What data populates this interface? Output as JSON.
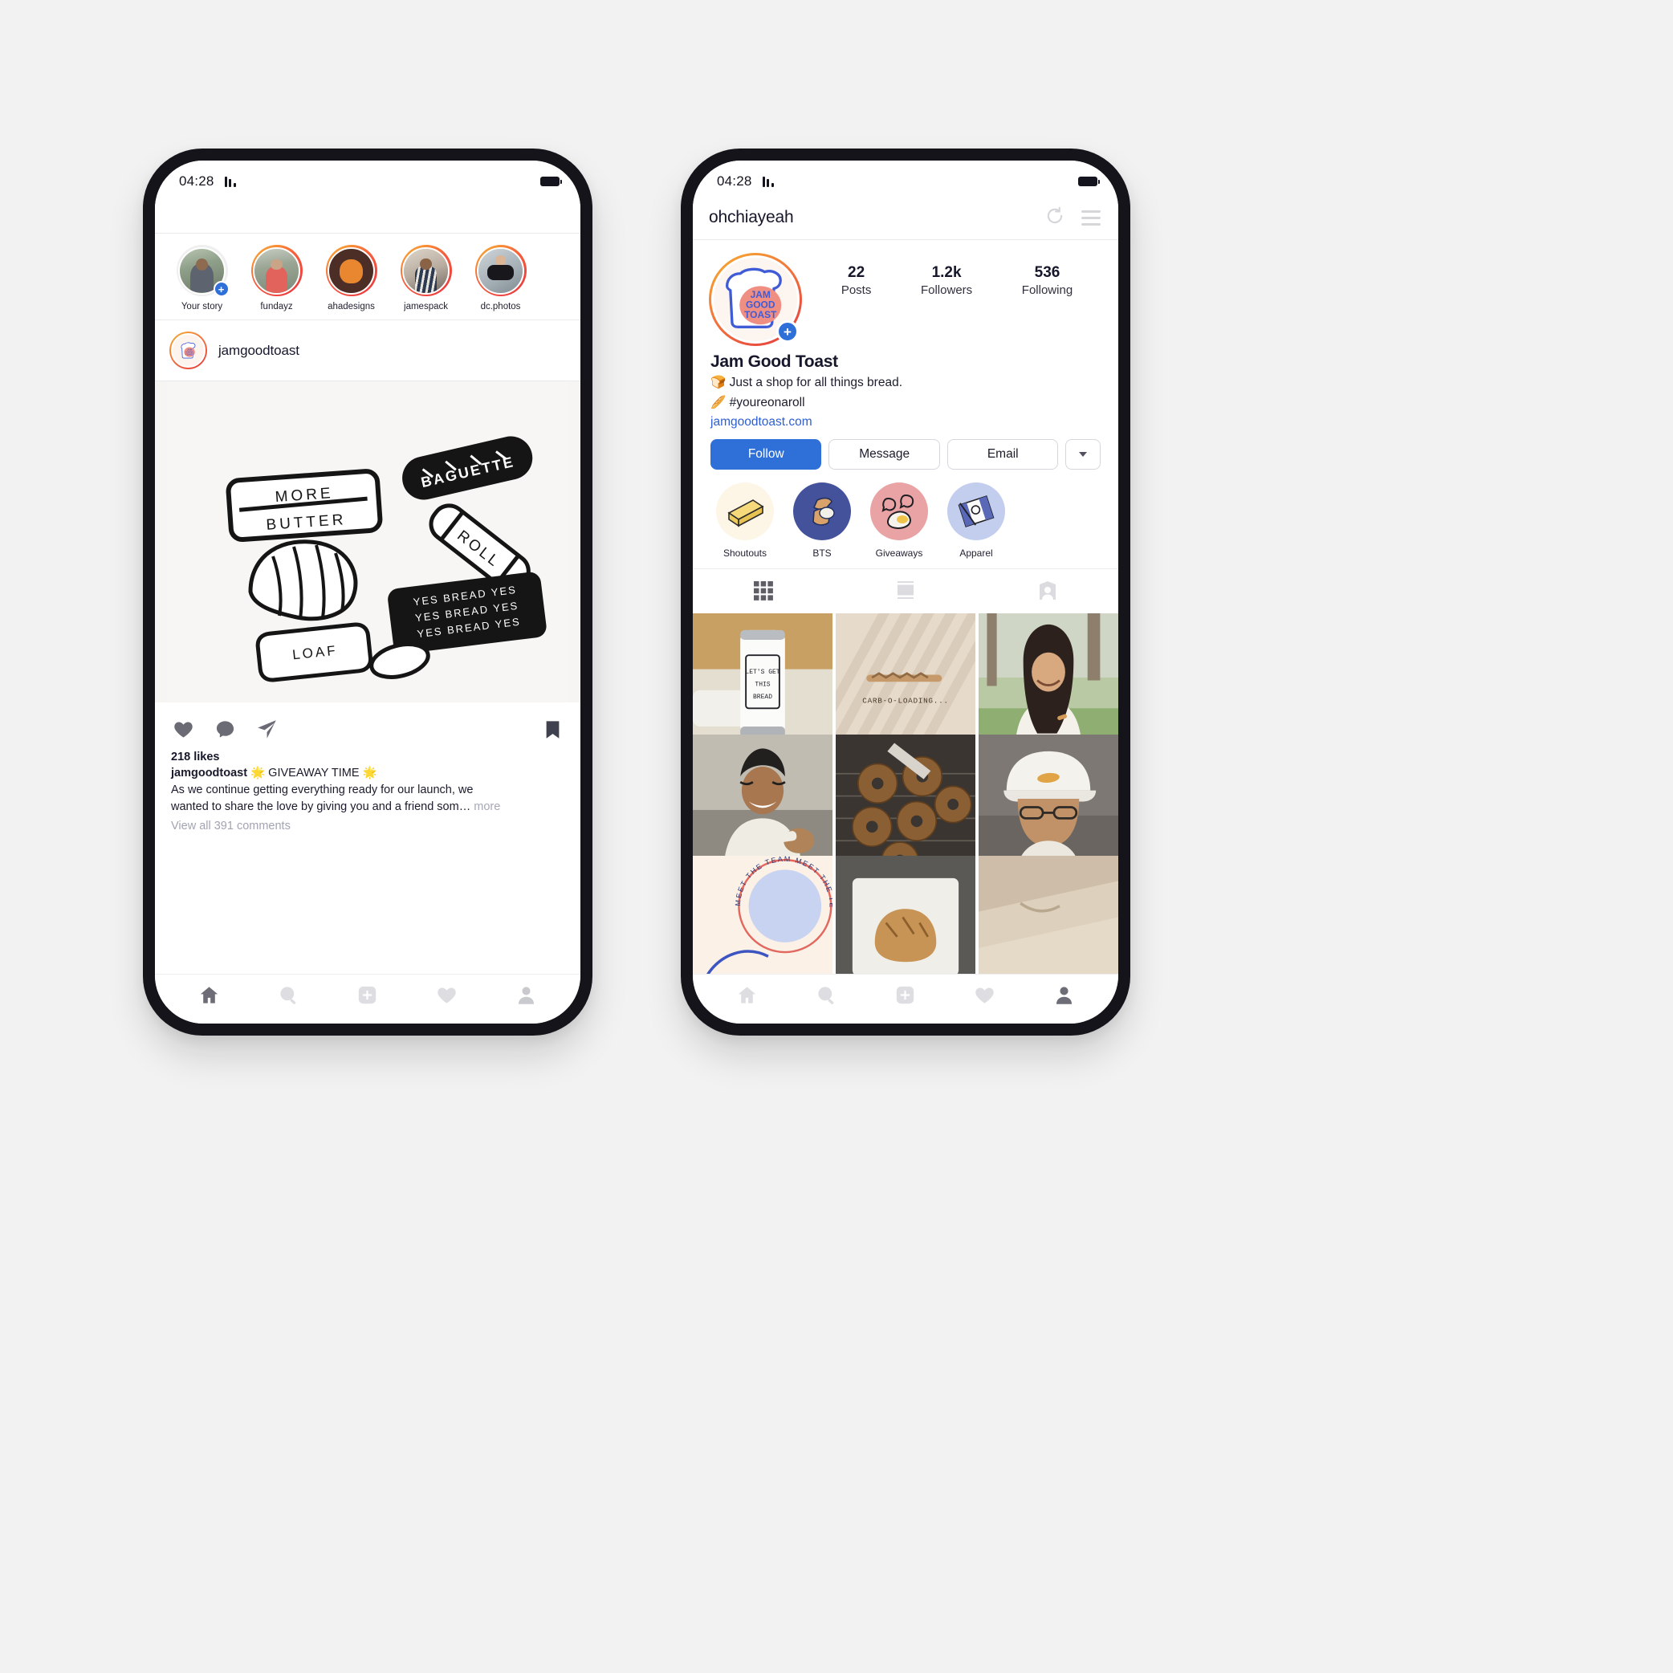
{
  "status_bar": {
    "time": "04:28",
    "signal_icon": "signal-bars-icon",
    "battery_icon": "battery-icon"
  },
  "feed_phone": {
    "stories": [
      {
        "label": "Your story",
        "has_ring": false,
        "has_add": true,
        "avatar": "woman-in-park-avatar"
      },
      {
        "label": "fundayz",
        "has_ring": true,
        "has_add": false,
        "avatar": "woman-red-top-avatar"
      },
      {
        "label": "ahadesigns",
        "has_ring": true,
        "has_add": false,
        "avatar": "illustrated-face-avatar"
      },
      {
        "label": "jamespack",
        "has_ring": true,
        "has_add": false,
        "avatar": "man-striped-shirt-avatar"
      },
      {
        "label": "dc.photos",
        "has_ring": true,
        "has_add": false,
        "avatar": "photographer-camera-avatar"
      }
    ],
    "post": {
      "username": "jamgoodtoast",
      "avatar_name": "jam-good-toast-logo",
      "image_alt": "bread-sticker-flatlay",
      "stickers": [
        {
          "text": "MORE BUTTER",
          "style": "outline"
        },
        {
          "text": "BAGUETTE",
          "style": "black"
        },
        {
          "text": "ROLL",
          "style": "outline"
        },
        {
          "text": "YES BREAD YES BREAD YES BREAD YES",
          "style": "black"
        },
        {
          "text": "LOAF",
          "style": "outline"
        },
        {
          "text": "croissant",
          "style": "outline"
        }
      ],
      "likes": "218 likes",
      "caption_user": "jamgoodtoast",
      "caption_headline": "🌟 GIVEAWAY TIME 🌟",
      "caption_line1": "As we continue getting everything ready for our launch, we",
      "caption_line2": "wanted to share the love by giving you and a friend som…",
      "caption_more": "more",
      "comments": "View all 391 comments",
      "actions": [
        "heart-icon",
        "comment-icon",
        "share-icon",
        "bookmark-icon"
      ]
    },
    "bottom_nav": [
      "home-icon",
      "search-icon",
      "add-post-icon",
      "heart-icon",
      "profile-icon"
    ]
  },
  "profile_phone": {
    "header": {
      "handle": "ohchiayeah",
      "refresh_icon": "refresh-icon",
      "menu_icon": "hamburger-menu-icon"
    },
    "avatar_name": "jam-good-toast-logo",
    "avatar_add_badge": "+",
    "stats": [
      {
        "value": "22",
        "label": "Posts"
      },
      {
        "value": "1.2k",
        "label": "Followers"
      },
      {
        "value": "536",
        "label": "Following"
      }
    ],
    "bio": {
      "name": "Jam Good Toast",
      "line1": "🍞 Just a shop for all things bread.",
      "line2": "🥖 #youreonaroll",
      "link": "jamgoodtoast.com"
    },
    "buttons": {
      "follow": "Follow",
      "message": "Message",
      "email": "Email",
      "more_icon": "chevron-down-icon"
    },
    "highlights": [
      {
        "label": "Shoutouts",
        "color": "#fdf5e6",
        "icon": "butter-stick-icon"
      },
      {
        "label": "BTS",
        "color": "#44529b",
        "icon": "bread-slices-icon"
      },
      {
        "label": "Giveaways",
        "color": "#e9a3a4",
        "icon": "egg-speech-icon"
      },
      {
        "label": "Apparel",
        "color": "#c3cdee",
        "icon": "tshirt-tag-icon"
      }
    ],
    "tabs": [
      {
        "name": "grid-tab",
        "icon": "grid-icon",
        "active": true
      },
      {
        "name": "feed-tab",
        "icon": "list-view-icon",
        "active": false
      },
      {
        "name": "tagged-tab",
        "icon": "tagged-person-icon",
        "active": false
      }
    ],
    "grid": [
      {
        "caption": "LET'S GET THIS BREAD",
        "kind": "tumbler-photo"
      },
      {
        "caption": "CARB-O-LOADING...",
        "kind": "tshirt-photo"
      },
      {
        "caption": "",
        "kind": "woman-white-tee-photo"
      },
      {
        "caption": "",
        "kind": "man-reaching-photo"
      },
      {
        "caption": "",
        "kind": "bagels-rack-photo"
      },
      {
        "caption": "",
        "kind": "man-white-cap-photo"
      },
      {
        "caption": "MEET THE TEAM",
        "kind": "team-badge-photo"
      },
      {
        "caption": "",
        "kind": "bread-marble-photo"
      },
      {
        "caption": "",
        "kind": "folded-tee-photo"
      }
    ],
    "bottom_nav": [
      "home-icon",
      "search-icon",
      "add-post-icon",
      "heart-icon",
      "profile-icon"
    ]
  },
  "colors": {
    "accent_blue": "#2f6fd8",
    "story_ring_start": "#f5b02e",
    "story_ring_end": "#e23a3f",
    "link_blue": "#2d5fd0",
    "page_bg": "#f2f2f2"
  }
}
